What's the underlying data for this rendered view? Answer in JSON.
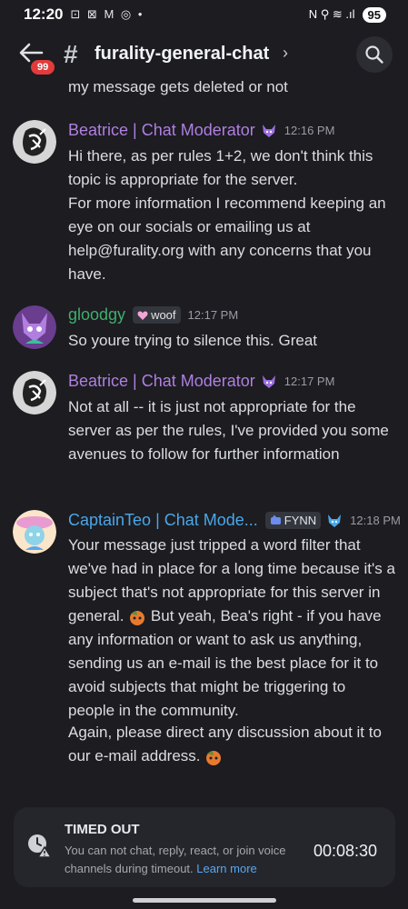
{
  "status_bar": {
    "time": "12:20",
    "left_icons": "⊡ ⊠ M ◎ •",
    "right_icons": "N ⚲ ≋ .ıl",
    "battery": "95"
  },
  "header": {
    "channel_name": "furality-general-chat",
    "unread_badge": "99",
    "chevron": "›"
  },
  "chat": {
    "cut_off_text": "my message gets deleted or not",
    "messages": [
      {
        "author": "Beatrice | Chat Moderator",
        "time": "12:16 PM",
        "lines": [
          "Hi there, as per rules 1+2, we don't think this topic is appropriate for the server.",
          "For more information I recommend keeping an eye on our socials or emailing us at help@furality.org with any concerns that you have."
        ]
      },
      {
        "author": "gloodgy",
        "tag": "woof",
        "time": "12:17 PM",
        "lines": [
          "So youre trying to silence this. Great"
        ]
      },
      {
        "author": "Beatrice | Chat Moderator",
        "time": "12:17 PM",
        "lines": [
          "Not at all -- it is just not appropriate for the server as per the rules, I've provided you some avenues to follow for further information"
        ]
      },
      {
        "author": "CaptainTeo | Chat Mode...",
        "tag": "FYNN",
        "time": "12:18 PM",
        "line1_a": "Your message just tripped a word filter that we've had in place for a long time because it's a subject that's not appropriate for this server in general.",
        "line1_b": "But yeah, Bea's right - if you have any information or want to ask us anything, sending us an e-mail is the best place for it to avoid subjects that might be triggering to people in the community.",
        "line2": "Again, please direct any discussion about it to our e-mail address."
      }
    ]
  },
  "timeout": {
    "title": "TIMED OUT",
    "description": "You can not chat, reply, react, or join voice channels during timeout.",
    "link": "Learn more",
    "timer": "00:08:30"
  },
  "colors": {
    "background": "#1c1c21",
    "moderator_name": "#b07fe0",
    "gloodgy_name": "#3fae6c",
    "captainteo_name": "#4aa7e8",
    "badge": "#e23b3b",
    "link": "#5aa6f0"
  },
  "icons": {
    "back": "back-arrow-icon",
    "search": "search-icon",
    "timeout": "clock-warning-icon",
    "moderator_emblem": "purple-fox-icon",
    "captainteo_emblem": "blue-fox-icon",
    "tag_woof": "heart-icon",
    "tag_fynn": "fynn-icon",
    "inline_emoji": "sneaky-fox-emoji"
  }
}
